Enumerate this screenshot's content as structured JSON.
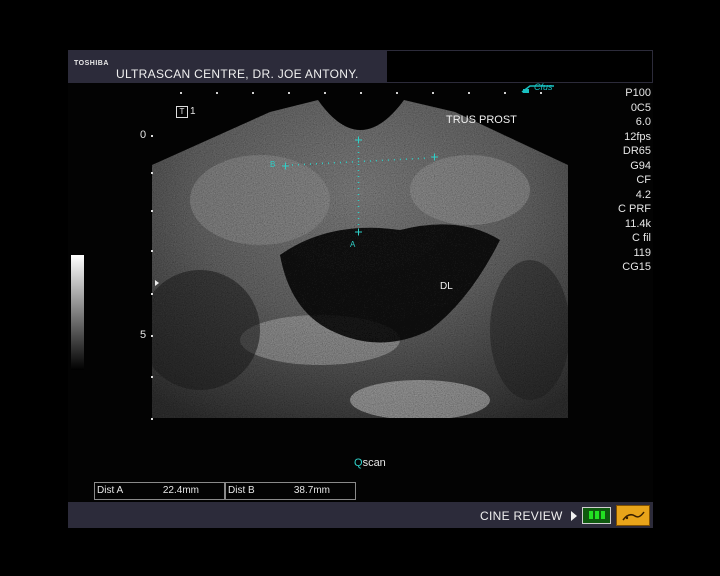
{
  "header": {
    "brand": "TOSHIBA",
    "clinic": "ULTRASCAN CENTRE, DR. JOE ANTONY."
  },
  "params": [
    "P100",
    "0C5",
    "6.0",
    "12fps",
    "DR65",
    "G94",
    "CF",
    "4.2",
    "C PRF",
    "11.4k",
    "C fil",
    "119",
    "CG15"
  ],
  "probe_label": "Cfus",
  "scan_mode": "T",
  "scan_mode_index": "1",
  "preset": "TRUS PROST",
  "depth_labels": {
    "top": "0",
    "mid": "5"
  },
  "annotations": {
    "region": "DL",
    "marker_a": "A",
    "marker_b": "B"
  },
  "qscan": {
    "q": "Q",
    "rest": "scan"
  },
  "measurements": [
    {
      "label": "Dist A",
      "value": "22.4mm"
    },
    {
      "label": "Dist B",
      "value": "38.7mm"
    }
  ],
  "footer": {
    "cine_review": "CINE REVIEW"
  },
  "colors": {
    "panel": "#2c2b3a",
    "caliper": "#2fd0c8",
    "cine_indicator": "#22e022",
    "icon_bg": "#e8a41a"
  }
}
